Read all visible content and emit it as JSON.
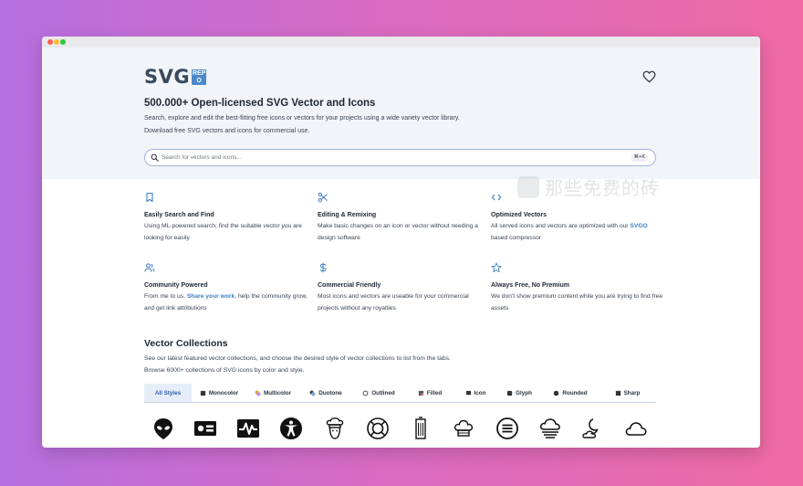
{
  "brand": {
    "logo_text": "SVG",
    "logo_badge": "REPO"
  },
  "hero": {
    "title": "500.000+ Open-licensed SVG Vector and Icons",
    "subtitle_lines": [
      "Search, explore and edit the best-fitting free icons or vectors for your projects using a wide variety vector library.",
      "Download free SVG vectors and icons for commercial use."
    ],
    "search": {
      "placeholder": "Search for vectors and icons...",
      "shortcut": "⌘+K"
    }
  },
  "watermark": {
    "text": "那些免费的砖"
  },
  "features": [
    {
      "icon": "bookmark-icon",
      "title": "Easily Search and Find",
      "desc": "Using ML-powered search, find the suitable vector you are looking for easily"
    },
    {
      "icon": "scissors-icon",
      "title": "Editing & Remixing",
      "desc": "Make basic changes on an icon or vector without needing a design software"
    },
    {
      "icon": "code-icon",
      "title": "Optimized Vectors",
      "desc_before": "All served icons and vectors are optimized with our ",
      "desc_link": "SVGO",
      "desc_after": " based compressor"
    },
    {
      "icon": "users-icon",
      "title": "Community Powered",
      "desc_before": "From me to us. ",
      "desc_link": "Share your work",
      "desc_after": ", help the community grow, and get link attributions"
    },
    {
      "icon": "dollar-icon",
      "title": "Commercial Friendly",
      "desc": "Most icons and vectors are useable for your commercial projects without any royalties"
    },
    {
      "icon": "star-icon",
      "title": "Always Free, No Premium",
      "desc": "We don't show premium content while you are trying to find free assets"
    }
  ],
  "collections": {
    "title": "Vector Collections",
    "subtitle_lines": [
      "See our latest featured vector collections, and choose the desired style of vector collections to list from the tabs.",
      "Browse 6000+ collections of SVG icons by color and style."
    ],
    "tabs": [
      {
        "label": "All Styles",
        "active": true
      },
      {
        "label": "Monocolor"
      },
      {
        "label": "Multicolor"
      },
      {
        "label": "Duotone"
      },
      {
        "label": "Outlined"
      },
      {
        "label": "Filled"
      },
      {
        "label": "Icon"
      },
      {
        "label": "Glyph"
      },
      {
        "label": "Rounded"
      },
      {
        "label": "Sharp"
      }
    ],
    "preview_icons": [
      "alien-icon",
      "id-card-icon",
      "heartbeat-icon",
      "accessibility-icon",
      "chef-icon",
      "lifebuoy-icon",
      "building-icon",
      "chef-hat-icon",
      "list-circle-icon",
      "fog-icon",
      "moon-cloud-icon",
      "cloud-icon"
    ]
  },
  "colors": {
    "accent": "#3b7fc4",
    "hero_bg": "#f1f4f9",
    "text_dark": "#1d2733"
  }
}
